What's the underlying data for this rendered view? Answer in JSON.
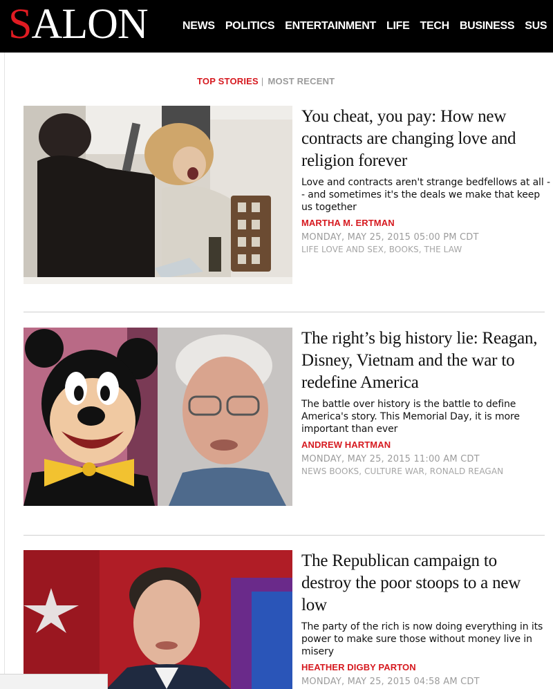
{
  "site": {
    "logo_first": "S",
    "logo_rest": "ALON"
  },
  "nav": [
    "NEWS",
    "POLITICS",
    "ENTERTAINMENT",
    "LIFE",
    "TECH",
    "BUSINESS",
    "SUS"
  ],
  "tabs": {
    "active": "TOP STORIES",
    "separator": "|",
    "inactive": "MOST RECENT"
  },
  "stories": [
    {
      "headline": "You cheat, you pay: How new contracts are changing love and religion forever",
      "dek": "Love and contracts aren't strange bedfellows at all -- and sometimes it's the deals we make that keep us together",
      "author": "MARTHA M. ERTMAN",
      "date": "MONDAY, MAY 25, 2015 05:00 PM CDT",
      "tags": "LIFE LOVE AND SEX, BOOKS, THE LAW"
    },
    {
      "headline": "The right’s big history lie: Reagan, Disney, Vietnam and the war to redefine America",
      "dek": "The battle over history is the battle to define America's story. This Memorial Day, it is more important than ever",
      "author": "ANDREW HARTMAN",
      "date": "MONDAY, MAY 25, 2015 11:00 AM CDT",
      "tags": "NEWS BOOKS, CULTURE WAR, RONALD REAGAN"
    },
    {
      "headline": "The Republican campaign to destroy the poor stoops to a new low",
      "dek": "The party of the rich is now doing everything in its power to make sure those without money live in misery",
      "author": "HEATHER DIGBY PARTON",
      "date": "MONDAY, MAY 25, 2015 04:58 AM CDT"
    }
  ],
  "colors": {
    "brand_red": "#d6191f",
    "header_bg": "#000000",
    "meta_gray": "#9c9c9c"
  }
}
